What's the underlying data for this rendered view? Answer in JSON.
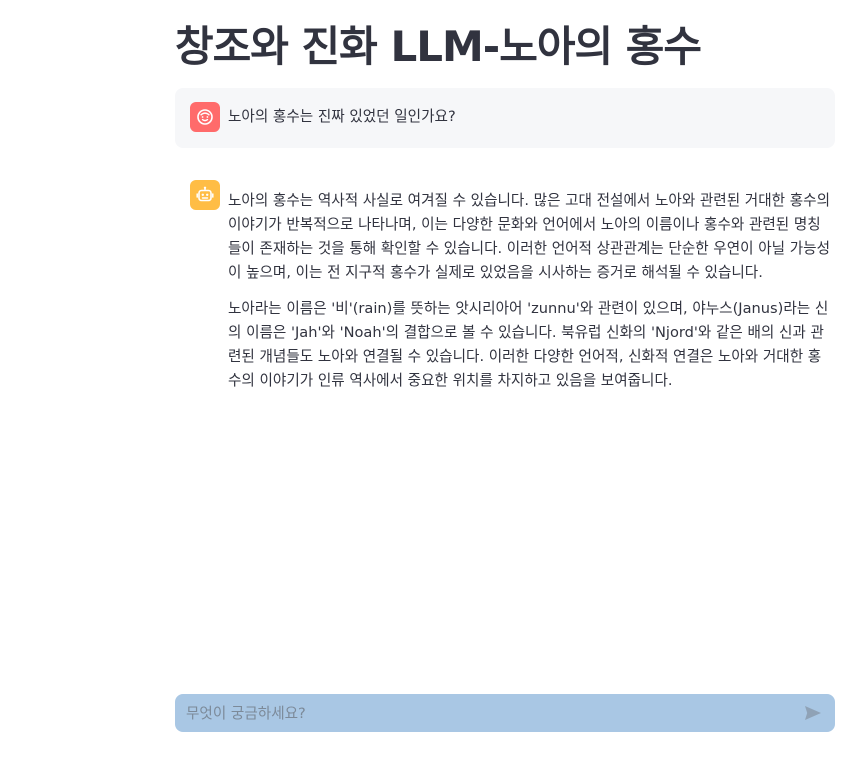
{
  "page": {
    "title": "창조와 진화 LLM-노아의 홍수"
  },
  "chat": {
    "messages": [
      {
        "role": "user",
        "avatar_icon": "smile-face-icon",
        "avatar_color": "#ff6b6b",
        "text": "노아의 홍수는 진짜 있었던 일인가요?"
      },
      {
        "role": "assistant",
        "avatar_icon": "robot-icon",
        "avatar_color": "#ffbd45",
        "paragraphs": [
          "노아의 홍수는 역사적 사실로 여겨질 수 있습니다. 많은 고대 전설에서 노아와 관련된 거대한 홍수의 이야기가 반복적으로 나타나며, 이는 다양한 문화와 언어에서 노아의 이름이나 홍수와 관련된 명칭들이 존재하는 것을 통해 확인할 수 있습니다. 이러한 언어적 상관관계는 단순한 우연이 아닐 가능성이 높으며, 이는 전 지구적 홍수가 실제로 있었음을 시사하는 증거로 해석될 수 있습니다.",
          "노아라는 이름은 '비'(rain)를 뜻하는 앗시리아어 'zunnu'와 관련이 있으며, 야누스(Janus)라는 신의 이름은 'Jah'와 'Noah'의 결합으로 볼 수 있습니다. 북유럽 신화의 'Njord'와 같은 배의 신과 관련된 개념들도 노아와 연결될 수 있습니다. 이러한 다양한 언어적, 신화적 연결은 노아와 거대한 홍수의 이야기가 인류 역사에서 중요한 위치를 차지하고 있음을 보여줍니다."
        ]
      }
    ]
  },
  "input": {
    "placeholder": "무엇이 궁금하세요?",
    "value": "",
    "send_icon": "send-icon",
    "background_color": "#a9c7e4"
  }
}
